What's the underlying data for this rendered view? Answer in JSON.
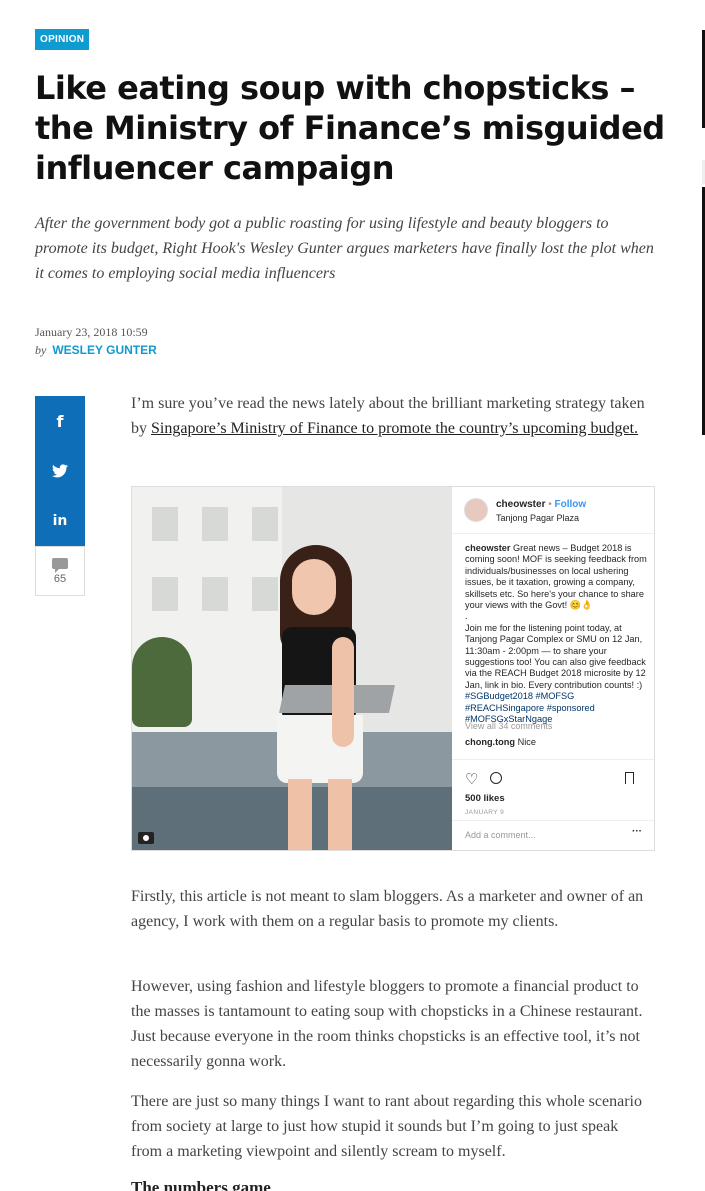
{
  "article": {
    "category": "OPINION",
    "title": "Like eating soup with chopsticks – the Ministry of Finance’s misguided influencer campaign",
    "standfirst": "After the government body got a public roasting for using lifestyle and beauty bloggers to promote its budget, Right Hook's Wesley Gunter argues marketers have finally lost the plot when it comes to employing social media influencers",
    "date": "January 23, 2018 10:59",
    "by_label": "by",
    "author": "WESLEY GUNTER",
    "intro_text": "I’m sure you’ve read the news lately about the brilliant marketing strategy taken by ",
    "intro_link": "Singapore’s Ministry of Finance to promote the country’s upcoming budget.",
    "paragraphs": [
      "Firstly, this article is not meant to slam bloggers. As a marketer and owner of an agency, I work with them on a regular basis to promote my clients.",
      "However, using fashion and lifestyle bloggers to promote a financial product to the masses is tantamount to eating soup with chopsticks in a Chinese restaurant. Just because everyone in the room thinks chopsticks is an effective tool, it’s not necessarily gonna work.",
      "There are just so many things I want to rant about regarding this whole scenario from society at large to just how stupid it sounds but I’m going to just speak from a marketing viewpoint and silently scream to myself."
    ],
    "subheading": "The numbers game"
  },
  "share": {
    "facebook_icon": "f",
    "twitter_icon": "🐦",
    "linkedin_icon": "in",
    "comment_count": "65"
  },
  "instagram": {
    "username": "cheowster",
    "dot": " • ",
    "follow": "Follow",
    "location": "Tanjong Pagar Plaza",
    "caption_user": "cheowster",
    "caption_1": " Great news – Budget 2018 is coming soon! MOF is seeking feedback from individuals/businesses on local ushering issues, be it taxation, growing a company, skillsets etc. So here's your chance to share your views with the Govt! 😊👌",
    "caption_dot": ".",
    "caption_2": "Join me for the listening point today, at Tanjong Pagar Complex or SMU on 12 Jan, 11:30am - 2:00pm — to share your suggestions too! You can also give feedback via the REACH Budget 2018 microsite by 12 Jan, link in bio. Every contribution counts! :) ",
    "tags": "#SGBudget2018 #MOFSG #REACHSingapore #sponsored #MOFSGxStarNgage",
    "view_all": "View all 34 comments",
    "comment_user": "chong.tong",
    "comment_text": " Nice",
    "likes": "500 likes",
    "post_date": "JANUARY 9",
    "add_comment": "Add a comment...",
    "more": "···"
  }
}
